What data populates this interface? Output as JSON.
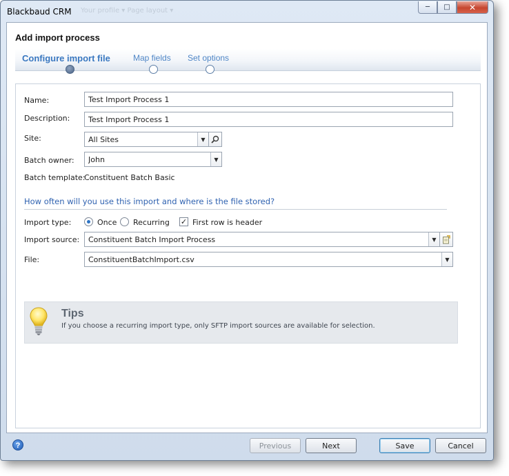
{
  "window": {
    "title": "Blackbaud CRM",
    "background_toolbar_ghost": "Your profile ▾   Page layout ▾"
  },
  "dialog": {
    "title": "Add import process",
    "steps": [
      {
        "label": "Configure import file",
        "active": true
      },
      {
        "label": "Map fields",
        "active": false
      },
      {
        "label": "Set options",
        "active": false
      }
    ]
  },
  "form": {
    "name_label": "Name:",
    "name_value": "Test Import Process 1",
    "description_label": "Description:",
    "description_value": "Test Import Process 1",
    "site_label": "Site:",
    "site_value": "All Sites",
    "batch_owner_label": "Batch owner:",
    "batch_owner_value": "John",
    "batch_template_label": "Batch template:",
    "batch_template_value": "Constituent Batch Basic",
    "section_heading": "How often will you use this import and where is the file stored?",
    "import_type_label": "Import type:",
    "import_type_options": [
      {
        "label": "Once",
        "selected": true
      },
      {
        "label": "Recurring",
        "selected": false
      }
    ],
    "first_row_header_label": "First row is header",
    "first_row_header_checked": true,
    "import_source_label": "Import source:",
    "import_source_value": "Constituent Batch Import Process",
    "file_label": "File:",
    "file_value": "ConstituentBatchImport.csv"
  },
  "tips": {
    "title": "Tips",
    "text": "If you choose a recurring import type, only SFTP import sources are available for selection."
  },
  "footer": {
    "help_glyph": "?",
    "previous_label": "Previous",
    "next_label": "Next",
    "save_label": "Save",
    "cancel_label": "Cancel"
  },
  "icons": {
    "search": "search-icon",
    "edit_source": "edit-document-icon",
    "tips": "lightbulb-icon",
    "help": "help-icon"
  },
  "colors": {
    "step_active": "#3a78c0",
    "section_heading": "#2f62b0",
    "radio_selected": "#2e74c4"
  }
}
